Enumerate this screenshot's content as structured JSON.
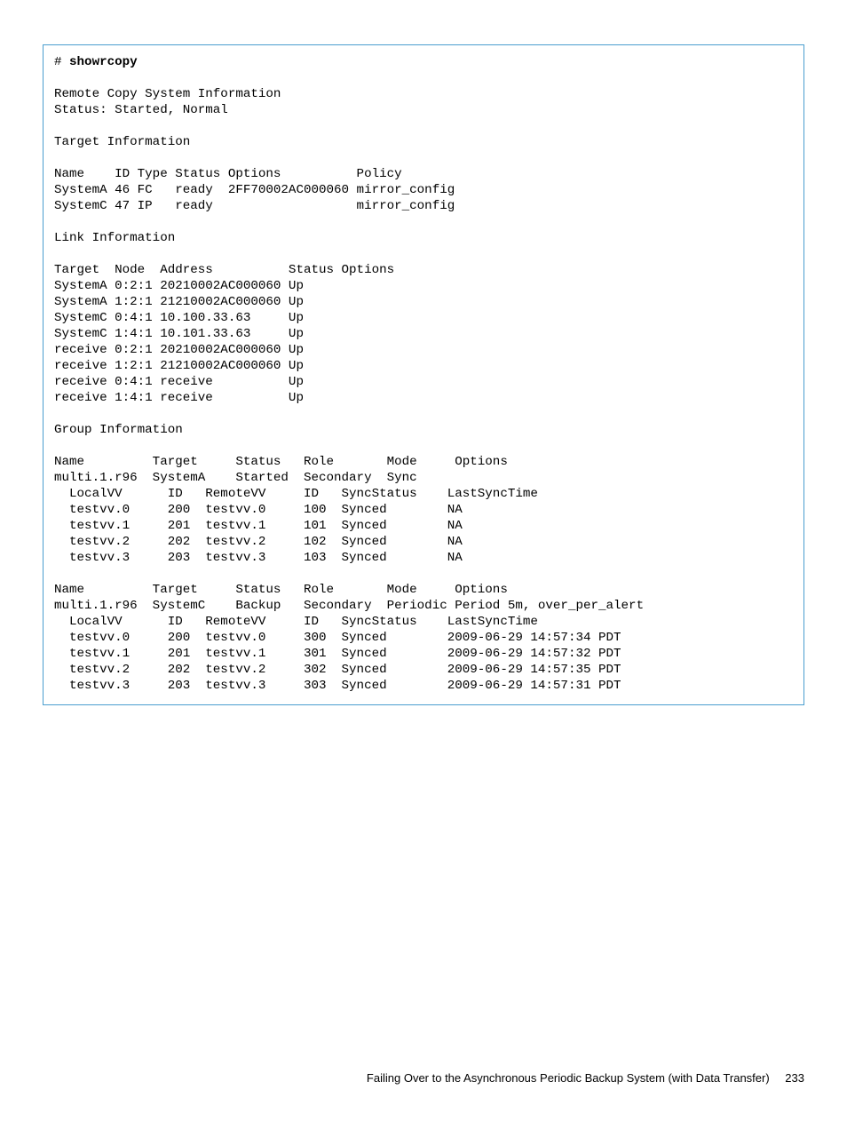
{
  "command": {
    "prompt": "# ",
    "name": "showrcopy"
  },
  "sysinfo_header": "Remote Copy System Information",
  "status_line": "Status: Started, Normal",
  "target_info_header": "Target Information",
  "target_table": {
    "header": "Name    ID Type Status Options          Policy",
    "rows": [
      "SystemA 46 FC   ready  2FF70002AC000060 mirror_config",
      "SystemC 47 IP   ready                   mirror_config"
    ]
  },
  "link_info_header": "Link Information",
  "link_table": {
    "header": "Target  Node  Address          Status Options",
    "rows": [
      "SystemA 0:2:1 20210002AC000060 Up",
      "SystemA 1:2:1 21210002AC000060 Up",
      "SystemC 0:4:1 10.100.33.63     Up",
      "SystemC 1:4:1 10.101.33.63     Up",
      "receive 0:2:1 20210002AC000060 Up",
      "receive 1:2:1 21210002AC000060 Up",
      "receive 0:4:1 receive          Up",
      "receive 1:4:1 receive          Up"
    ]
  },
  "group_info_header": "Group Information",
  "groups": [
    {
      "header": "Name         Target     Status   Role       Mode     Options",
      "summary": "multi.1.r96  SystemA    Started  Secondary  Sync",
      "vv_header": "  LocalVV      ID   RemoteVV     ID   SyncStatus    LastSyncTime",
      "vv_rows": [
        "  testvv.0     200  testvv.0     100  Synced        NA",
        "  testvv.1     201  testvv.1     101  Synced        NA",
        "  testvv.2     202  testvv.2     102  Synced        NA",
        "  testvv.3     203  testvv.3     103  Synced        NA"
      ]
    },
    {
      "header": "Name         Target     Status   Role       Mode     Options",
      "summary": "multi.1.r96  SystemC    Backup   Secondary  Periodic Period 5m, over_per_alert",
      "vv_header": "  LocalVV      ID   RemoteVV     ID   SyncStatus    LastSyncTime",
      "vv_rows": [
        "  testvv.0     200  testvv.0     300  Synced        2009-06-29 14:57:34 PDT",
        "  testvv.1     201  testvv.1     301  Synced        2009-06-29 14:57:32 PDT",
        "  testvv.2     202  testvv.2     302  Synced        2009-06-29 14:57:35 PDT",
        "  testvv.3     203  testvv.3     303  Synced        2009-06-29 14:57:31 PDT"
      ]
    }
  ],
  "footer": {
    "text": "Failing Over to the Asynchronous Periodic Backup System (with Data Transfer)",
    "page": "233"
  }
}
